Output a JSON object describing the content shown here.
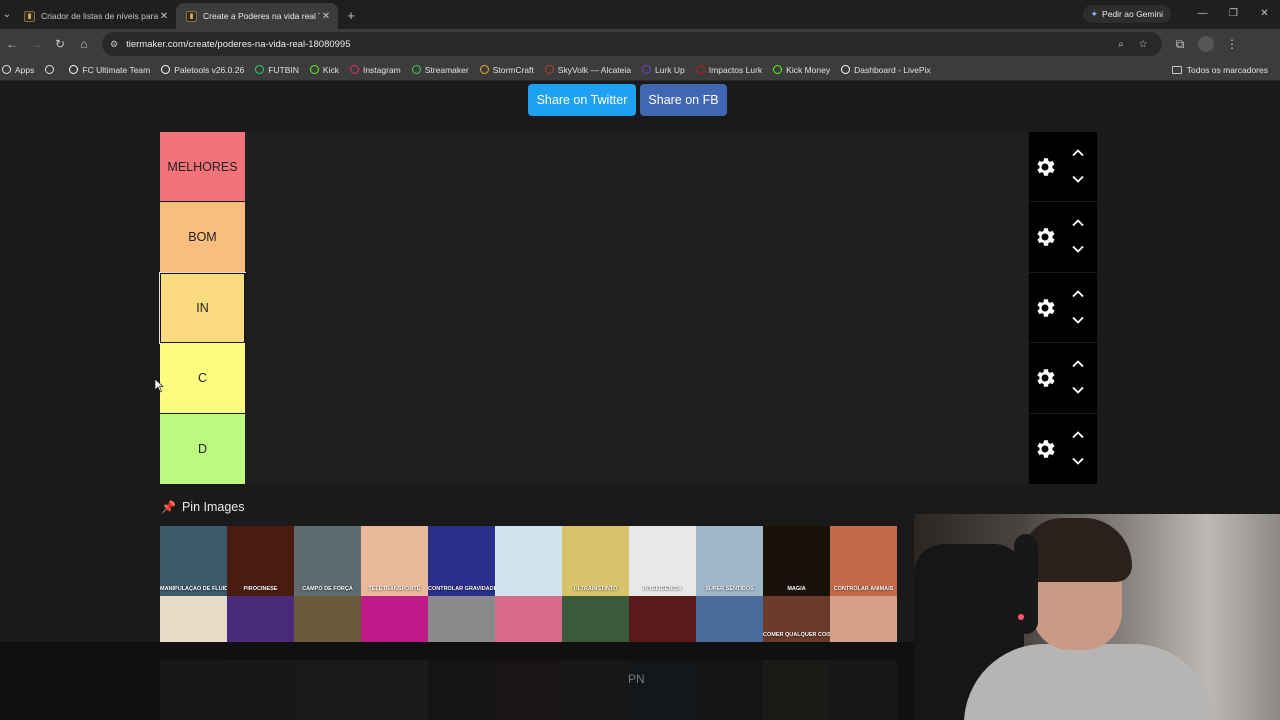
{
  "browser": {
    "tabs": [
      {
        "title": "Criador de listas de níveis para",
        "active": false
      },
      {
        "title": "Create a Poderes na vida real Ti",
        "active": true
      }
    ],
    "gemini_label": "Pedir ao Gemini",
    "url": "tiermaker.com/create/poderes-na-vida-real-18080995",
    "bookmarks": [
      {
        "label": "Apps",
        "icon": "apps-icon",
        "color": "#e0e0e0"
      },
      {
        "label": "",
        "icon": "grid-icon",
        "color": "#e0e0e0"
      },
      {
        "label": "FC Ultimate Team",
        "icon": "fc-icon",
        "color": "#ffffff"
      },
      {
        "label": "Paletools v26.0.26",
        "icon": "paletools-icon",
        "color": "#ffffff"
      },
      {
        "label": "FUTBIN",
        "icon": "futbin-icon",
        "color": "#2ecc71"
      },
      {
        "label": "Kick",
        "icon": "kick-icon",
        "color": "#53fc18"
      },
      {
        "label": "Instagram",
        "icon": "instagram-icon",
        "color": "#e1306c"
      },
      {
        "label": "Streamaker",
        "icon": "streamaker-icon",
        "color": "#39d353"
      },
      {
        "label": "StormCraft",
        "icon": "stormcraft-icon",
        "color": "#f5a623"
      },
      {
        "label": "SkyVolk — Alcateia",
        "icon": "skyvolk-icon",
        "color": "#c0392b"
      },
      {
        "label": "Lurk Up",
        "icon": "lurkup-icon",
        "color": "#6c3fd1"
      },
      {
        "label": "Impactos Lurk",
        "icon": "impactos-icon",
        "color": "#b71c1c"
      },
      {
        "label": "Kick Money",
        "icon": "kickmoney-icon",
        "color": "#53fc18"
      },
      {
        "label": "Dashboard - LivePix",
        "icon": "livepix-icon",
        "color": "#ffffff"
      }
    ],
    "all_bookmarks_label": "Todos os marcadores"
  },
  "share": {
    "twitter_label": "Share on Twitter",
    "fb_label": "Share on FB",
    "twitter_color": "#1da1f2",
    "fb_color": "#4267b2"
  },
  "tiers": [
    {
      "label": "MELHORES",
      "color": "#f4727a"
    },
    {
      "label": "BOM",
      "color": "#f9bd7e"
    },
    {
      "label": "IN",
      "color": "#fbdb7f",
      "editing": true
    },
    {
      "label": "C",
      "color": "#fdfe7f"
    },
    {
      "label": "D",
      "color": "#bdf97e"
    }
  ],
  "pin_images_label": "Pin Images",
  "images_row1": [
    {
      "caption": "MANIPULAÇÃO DE FLUIDOS",
      "color": "#3b5a6b"
    },
    {
      "caption": "PIROCINESE",
      "color": "#4a1c10"
    },
    {
      "caption": "CAMPO DE FORÇA",
      "color": "#5d6b70"
    },
    {
      "caption": "TELETRANSPORTE",
      "color": "#e9b99a"
    },
    {
      "caption": "CONTROLAR GRAVIDADE",
      "color": "#2a2f8a"
    },
    {
      "caption": "",
      "color": "#cfe4ef"
    },
    {
      "caption": "ULTRAINSTINTO",
      "color": "#d9c36a"
    },
    {
      "caption": "INTELIGÊNCIA",
      "color": "#e8e8e8"
    },
    {
      "caption": "SUPER SENTIDOS",
      "color": "#9fb6c9"
    },
    {
      "caption": "MAGIA",
      "color": "#1a1208"
    },
    {
      "caption": "CONTROLAR ANIMAIS",
      "color": "#c46a4a"
    }
  ],
  "images_row2": [
    {
      "caption": "",
      "color": "#e8dcc8"
    },
    {
      "caption": "",
      "color": "#4a2a7a"
    },
    {
      "caption": "",
      "color": "#6a5a3a"
    },
    {
      "caption": "",
      "color": "#c01a8a"
    },
    {
      "caption": "",
      "color": "#8a8a8a"
    },
    {
      "caption": "",
      "color": "#d86a8a"
    },
    {
      "caption": "",
      "color": "#3a5a3a"
    },
    {
      "caption": "",
      "color": "#5a1a1a"
    },
    {
      "caption": "",
      "color": "#4a6a9a"
    },
    {
      "caption": "COMER QUALQUER COISA",
      "color": "#6a3a2a"
    },
    {
      "caption": "",
      "color": "#d6a08a"
    }
  ],
  "overlay_text": "PN"
}
